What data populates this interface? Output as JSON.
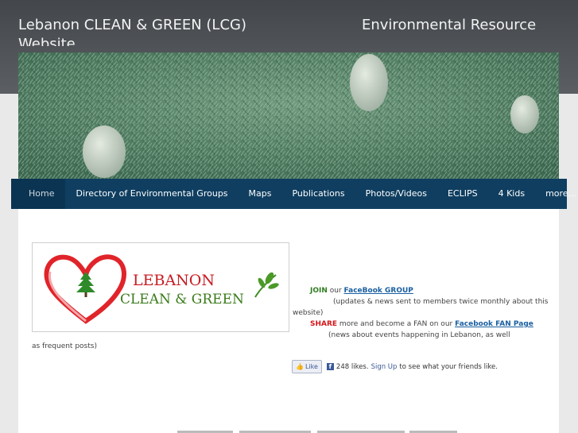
{
  "header": {
    "site_title": "Lebanon CLEAN & GREEN (LCG) Website",
    "tagline": "Environmental Resource"
  },
  "nav": {
    "items": [
      {
        "label": "Home",
        "active": true
      },
      {
        "label": "Directory of Environmental Groups"
      },
      {
        "label": "Maps"
      },
      {
        "label": "Publications"
      },
      {
        "label": "Photos/Videos"
      },
      {
        "label": "ECLIPS"
      },
      {
        "label": "4 Kids"
      },
      {
        "label": "more..."
      }
    ]
  },
  "logo": {
    "line1": "LEBANON",
    "line2": "CLEAN & GREEN"
  },
  "content": {
    "join_label": "JOIN",
    "join_text": " our ",
    "join_link": "FaceBook GROUP ",
    "join_note": "(updates & news sent to members twice monthly about this",
    "join_note2": "website)",
    "share_label": "SHARE",
    "share_text": " more and become a FAN on our ",
    "share_link": "Facebook FAN Page ",
    "share_note": "(news about events happening in Lebanon, as well",
    "share_note2": "as frequent posts)"
  },
  "like_widget": {
    "button_label": "Like",
    "fb_icon": "f",
    "count_text": "248 likes.",
    "signup_label": "Sign Up",
    "suffix_text": "to see what your friends like."
  },
  "colors": {
    "nav_bg": "#0f3e60",
    "header_bg": "#4a4e52",
    "logo_red": "#c71c22",
    "logo_green": "#3a7a1a"
  }
}
